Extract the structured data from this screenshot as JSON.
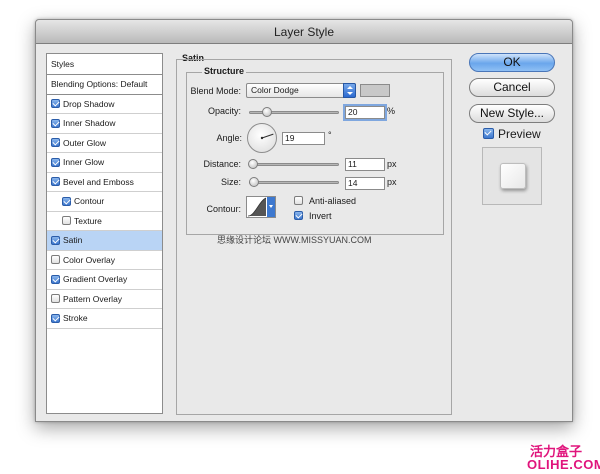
{
  "window": {
    "title": "Layer Style"
  },
  "sidebar": {
    "header": "Styles",
    "items": [
      {
        "label": "Blending Options: Default",
        "checkbox": false,
        "checked": false,
        "selected": false,
        "sub": false
      },
      {
        "label": "Drop Shadow",
        "checkbox": true,
        "checked": true,
        "selected": false,
        "sub": false
      },
      {
        "label": "Inner Shadow",
        "checkbox": true,
        "checked": true,
        "selected": false,
        "sub": false
      },
      {
        "label": "Outer Glow",
        "checkbox": true,
        "checked": true,
        "selected": false,
        "sub": false
      },
      {
        "label": "Inner Glow",
        "checkbox": true,
        "checked": true,
        "selected": false,
        "sub": false
      },
      {
        "label": "Bevel and Emboss",
        "checkbox": true,
        "checked": true,
        "selected": false,
        "sub": false
      },
      {
        "label": "Contour",
        "checkbox": true,
        "checked": true,
        "selected": false,
        "sub": true
      },
      {
        "label": "Texture",
        "checkbox": true,
        "checked": false,
        "selected": false,
        "sub": true
      },
      {
        "label": "Satin",
        "checkbox": true,
        "checked": true,
        "selected": true,
        "sub": false
      },
      {
        "label": "Color Overlay",
        "checkbox": true,
        "checked": false,
        "selected": false,
        "sub": false
      },
      {
        "label": "Gradient Overlay",
        "checkbox": true,
        "checked": true,
        "selected": false,
        "sub": false
      },
      {
        "label": "Pattern Overlay",
        "checkbox": true,
        "checked": false,
        "selected": false,
        "sub": false
      },
      {
        "label": "Stroke",
        "checkbox": true,
        "checked": true,
        "selected": false,
        "sub": false
      }
    ]
  },
  "satin": {
    "title": "Satin",
    "structure_title": "Structure",
    "blend_mode": {
      "label": "Blend Mode:",
      "value": "Color Dodge",
      "swatch_color": "#c8c8c8"
    },
    "opacity": {
      "label": "Opacity:",
      "value": "20",
      "unit": "%",
      "fraction": 0.2
    },
    "angle": {
      "label": "Angle:",
      "value": "19",
      "unit": "°",
      "degrees": 19
    },
    "distance": {
      "label": "Distance:",
      "value": "11",
      "unit": "px",
      "fraction": 0.045
    },
    "size": {
      "label": "Size:",
      "value": "14",
      "unit": "px",
      "fraction": 0.056
    },
    "contour": {
      "label": "Contour:",
      "anti_aliased": {
        "label": "Anti-aliased",
        "checked": false
      },
      "invert": {
        "label": "Invert",
        "checked": true
      }
    }
  },
  "buttons": {
    "ok": "OK",
    "cancel": "Cancel",
    "new_style": "New Style..."
  },
  "preview": {
    "label": "Preview",
    "checked": true
  },
  "watermark": {
    "text": "思缘设计论坛 WWW.MISSYUAN.COM"
  },
  "brand": {
    "cn": "活力盒子",
    "en": "OLIHE.COM"
  },
  "colors": {
    "accent": "#3d78cf",
    "selection": "#b9d4f5",
    "brand": "#e0147c"
  }
}
